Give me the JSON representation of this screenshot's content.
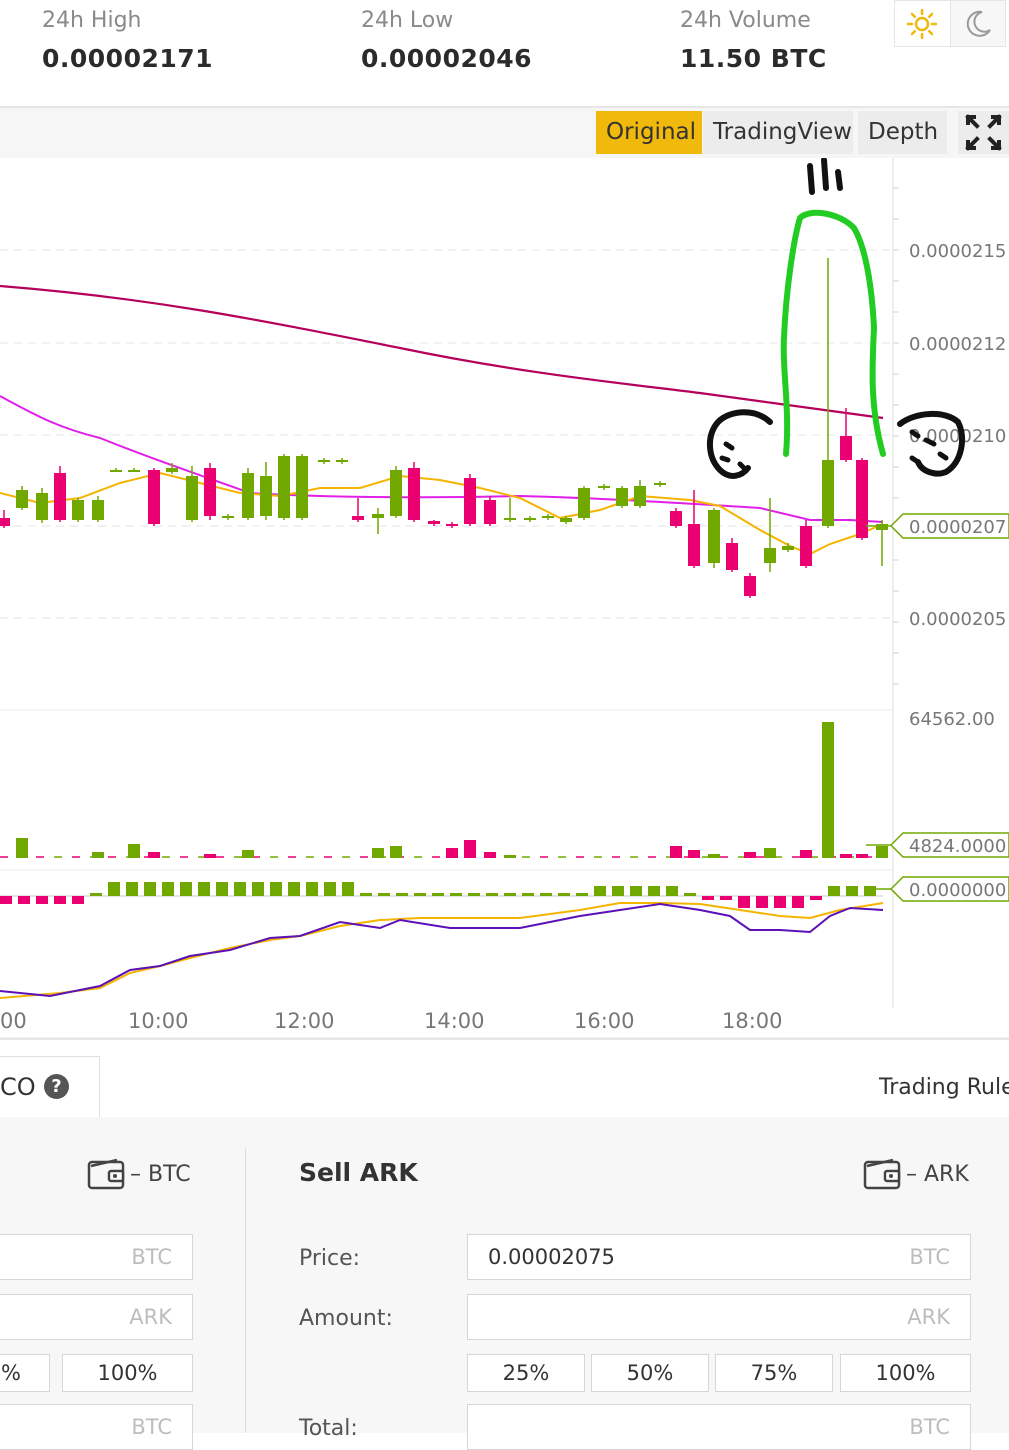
{
  "stats": {
    "high_label": "24h High",
    "high_value": "0.00002171",
    "low_label": "24h Low",
    "low_value": "0.00002046",
    "volume_label": "24h Volume",
    "volume_value": "11.50 BTC"
  },
  "theme": {
    "light_icon": "sun-icon",
    "dark_icon": "moon-icon",
    "active": "light"
  },
  "chart_tabs": [
    "Original",
    "TradingView",
    "Depth"
  ],
  "chart": {
    "price_labels": [
      "0.0000215",
      "0.0000212",
      "0.0000210",
      "0.0000207",
      "0.0000205"
    ],
    "current_price_tag": "0.0000207",
    "volume_max_label": "64562.00",
    "volume_tag": "4824.0000",
    "macd_tag": "0.0000000",
    "time_labels": [
      "00",
      "10:00",
      "12:00",
      "14:00",
      "16:00",
      "18:00"
    ],
    "colors": {
      "up": "#70a800",
      "down": "#ea0070",
      "ma_long": "#b5005b",
      "ma_mid": "#e020e8",
      "ma_short": "#f5b400",
      "macd": "#5b10b8",
      "signal": "#f5b400",
      "annotation_green": "#22cc22"
    }
  },
  "order_tabs": {
    "oco_label": "CO",
    "help_icon": "question-icon",
    "trading_rules": "Trading Rule"
  },
  "buy": {
    "wallet_icon": "wallet-icon",
    "balance": "– BTC",
    "price_unit": "BTC",
    "amount_unit": "ARK",
    "pct_partial": "%",
    "pct_100": "100%",
    "total_unit": "BTC"
  },
  "sell": {
    "title": "Sell ARK",
    "wallet_icon": "wallet-icon",
    "balance": "– ARK",
    "price_label": "Price:",
    "price_value": "0.00002075",
    "price_unit": "BTC",
    "amount_label": "Amount:",
    "amount_unit": "ARK",
    "pct": [
      "25%",
      "50%",
      "75%",
      "100%"
    ],
    "total_label": "Total:",
    "total_unit": "BTC"
  }
}
